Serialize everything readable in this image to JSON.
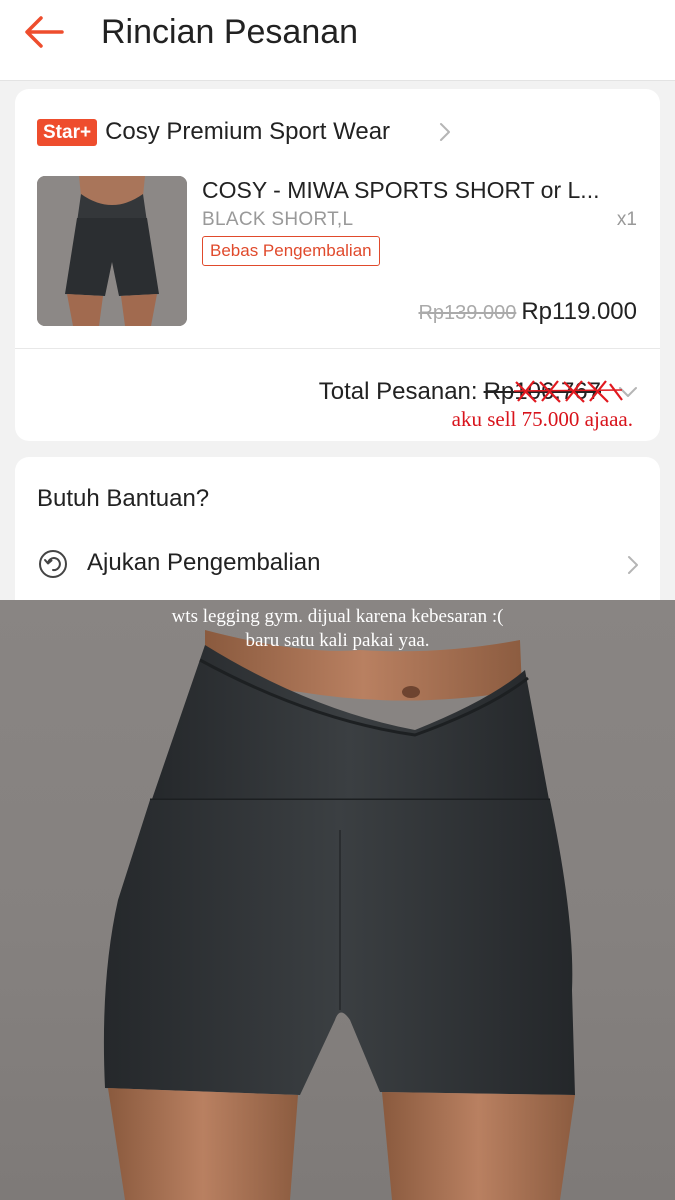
{
  "header": {
    "back_icon": "arrow-left-icon",
    "title": "Rincian Pesanan",
    "accent_color": "#ee4d2d"
  },
  "order": {
    "shop_badge": "Star+",
    "shop_name": "Cosy Premium Sport Wear",
    "shop_chevron_icon": "chevron-right-icon",
    "product_name": "COSY - MIWA SPORTS SHORT or L...",
    "variant": "BLACK SHORT,L",
    "quantity": "x1",
    "return_badge": "Bebas Pengembalian",
    "original_price": "Rp139.000",
    "price": "Rp119.000",
    "total_label": "Total Pesanan:",
    "total_value": "Rp106.767",
    "total_chevron_icon": "chevron-down-icon",
    "sell_note": "aku sell 75.000 ajaaa."
  },
  "help": {
    "title": "Butuh Bantuan?",
    "items": [
      {
        "label": "Ajukan Pengembalian",
        "icon": "return-icon",
        "chevron_icon": "chevron-right-icon"
      }
    ]
  },
  "photo": {
    "caption_line1": "wts legging gym. dijual karena kebesaran :(",
    "caption_line2": "baru satu kali pakai yaa."
  }
}
